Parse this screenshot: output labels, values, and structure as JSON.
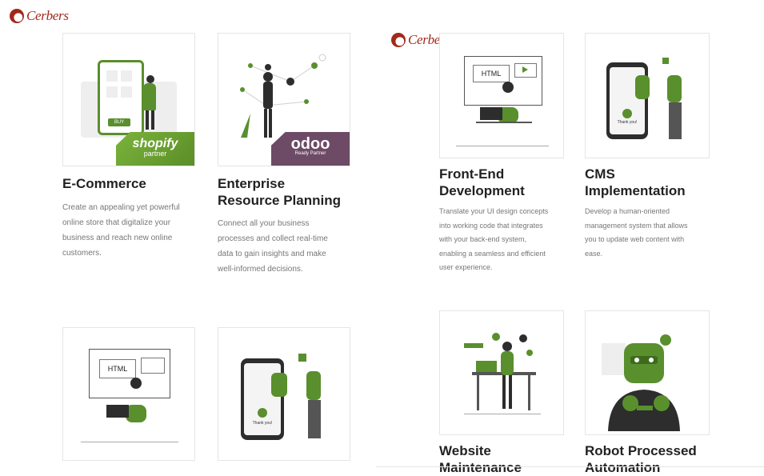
{
  "brand": {
    "name": "Cerbers"
  },
  "colors": {
    "brand": "#a2281c",
    "accent_green": "#5a8f2e",
    "odoo_purple": "#6d4a66"
  },
  "cards": [
    {
      "title_lines": [
        "E-Commerce"
      ],
      "desc_lines": [
        "Create an appealing yet powerful",
        "online store that digitalize your",
        "business and reach new online",
        "customers."
      ],
      "badge": {
        "brand": "shopify",
        "sub": "partner"
      },
      "illustration": "shopping-phone-icon",
      "phone_button": "BUY"
    },
    {
      "title_lines": [
        "Enterprise",
        "Resource Planning"
      ],
      "desc_lines": [
        "Connect all your business",
        "processes and collect real-time",
        "data to gain insights and make",
        "well-informed decisions."
      ],
      "badge": {
        "brand": "odoo",
        "sub": "Ready Partner"
      },
      "illustration": "data-network-icon"
    },
    {
      "title_lines": [
        "Front-End",
        "Development"
      ],
      "desc_lines": [
        "Translate your UI design concepts",
        "into working code that integrates",
        "with your back-end system,",
        "enabling a seamless and efficient",
        "user experience."
      ],
      "illustration": "html-developer-icon",
      "screen_text": "HTML"
    },
    {
      "title_lines": [
        "CMS",
        "Implementation"
      ],
      "desc_lines": [
        "Develop a human-oriented",
        "management system that allows",
        "you to update web content with",
        "ease."
      ],
      "illustration": "phone-thank-you-icon",
      "phone_text": "Thank you!"
    },
    {
      "illustration": "html-developer-icon",
      "screen_text": "HTML"
    },
    {
      "illustration": "phone-thank-you-icon",
      "phone_text": "Thank you!"
    },
    {
      "title_lines": [
        "Website",
        "Maintenance"
      ],
      "illustration": "juggling-desk-icon"
    },
    {
      "title_lines": [
        "Robot Processed",
        "Automation"
      ],
      "illustration": "robot-icon"
    }
  ]
}
